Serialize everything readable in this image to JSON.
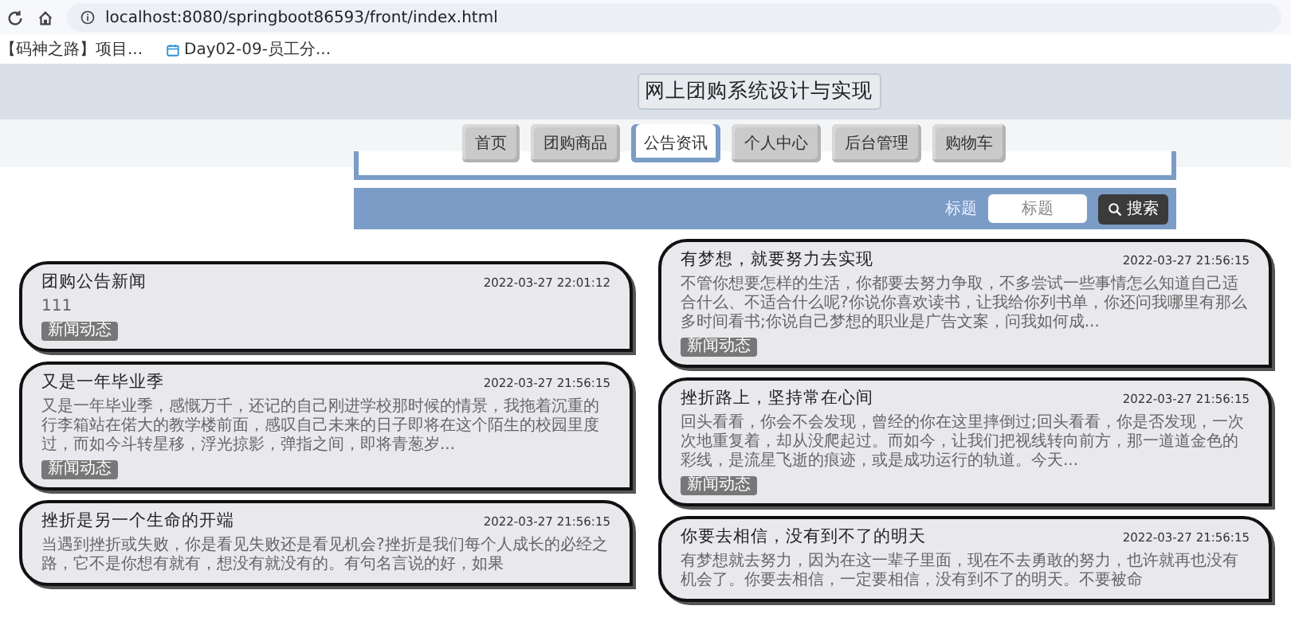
{
  "browser": {
    "url": "localhost:8080/springboot86593/front/index.html",
    "bookmarks": [
      {
        "kind": "page",
        "label": "【码神之路】项目..."
      },
      {
        "kind": "calendar",
        "label": "Day02-09-员工分..."
      }
    ]
  },
  "header": {
    "title": "网上团购系统设计与实现"
  },
  "nav": [
    {
      "label": "首页",
      "selected": false
    },
    {
      "label": "团购商品",
      "selected": false
    },
    {
      "label": "公告资讯",
      "selected": true
    },
    {
      "label": "个人中心",
      "selected": false
    },
    {
      "label": "后台管理",
      "selected": false
    },
    {
      "label": "购物车",
      "selected": false
    }
  ],
  "search": {
    "label": "标题",
    "placeholder": "标题",
    "button": "搜索"
  },
  "columns": [
    {
      "items": [
        {
          "title": "团购公告新闻",
          "date": "2022-03-27 22:01:12",
          "body": "111",
          "tag": "新闻动态"
        },
        {
          "title": "又是一年毕业季",
          "date": "2022-03-27 21:56:15",
          "body": "又是一年毕业季，感慨万千，还记的自己刚进学校那时候的情景，我拖着沉重的行李箱站在偌大的教学楼前面，感叹自己未来的日子即将在这个陌生的校园里度过，而如今斗转星移，浮光掠影，弹指之间，即将青葱岁...",
          "tag": "新闻动态"
        },
        {
          "title": "挫折是另一个生命的开端",
          "date": "2022-03-27 21:56:15",
          "body": "当遇到挫折或失败，你是看见失败还是看见机会?挫折是我们每个人成长的必经之路，它不是你想有就有，想没有就没有的。有句名言说的好，如果"
        }
      ]
    },
    {
      "items": [
        {
          "title": "有梦想，就要努力去实现",
          "date": "2022-03-27 21:56:15",
          "body": "不管你想要怎样的生活，你都要去努力争取，不多尝试一些事情怎么知道自己适合什么、不适合什么呢?你说你喜欢读书，让我给你列书单，你还问我哪里有那么多时间看书;你说自己梦想的职业是广告文案，问我如何成...",
          "tag": "新闻动态"
        },
        {
          "title": "挫折路上，坚持常在心间",
          "date": "2022-03-27 21:56:15",
          "body": "回头看看，你会不会发现，曾经的你在这里摔倒过;回头看看，你是否发现，一次次地重复着，却从没爬起过。而如今，让我们把视线转向前方，那一道道金色的彩线，是流星飞逝的痕迹，或是成功运行的轨道。今天...",
          "tag": "新闻动态"
        },
        {
          "title": "你要去相信，没有到不了的明天",
          "date": "2022-03-27 21:56:15",
          "body": "有梦想就去努力，因为在这一辈子里面，现在不去勇敢的努力，也许就再也没有机会了。你要去相信，一定要相信，没有到不了的明天。不要被命"
        }
      ]
    }
  ]
}
